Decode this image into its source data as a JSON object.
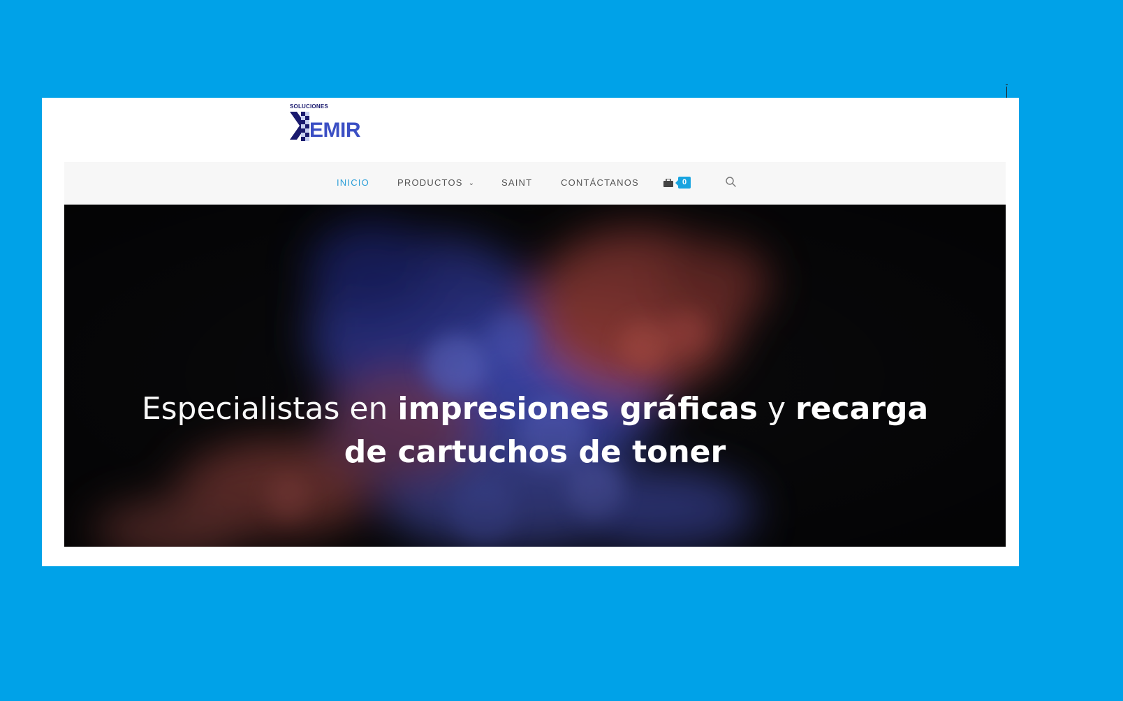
{
  "logo": {
    "small_text": "SOLUCIONES",
    "big_text": "EMIR",
    "colors": {
      "dark": "#1a1a6e",
      "accent": "#3b4fc4"
    }
  },
  "nav": {
    "items": [
      {
        "label": "INICIO",
        "active": true
      },
      {
        "label": "PRODUCTOS",
        "active": false,
        "has_dropdown": true
      },
      {
        "label": "SAINT",
        "active": false
      },
      {
        "label": "CONTÁCTANOS",
        "active": false
      }
    ],
    "cart_icon": "shopping-bag-icon",
    "cart_count": "0",
    "search_icon": "search-icon",
    "active_color": "#2d9fd8",
    "badge_color": "#18a4e0"
  },
  "hero": {
    "part1": "Especialistas en ",
    "part2": "impresiones gráficas",
    "part3": " y ",
    "part4": "recarga de cartuchos de toner"
  },
  "colors": {
    "page_background": "#00a2e8",
    "frame_background": "#ffffff",
    "navbar_background": "#f7f7f7"
  }
}
